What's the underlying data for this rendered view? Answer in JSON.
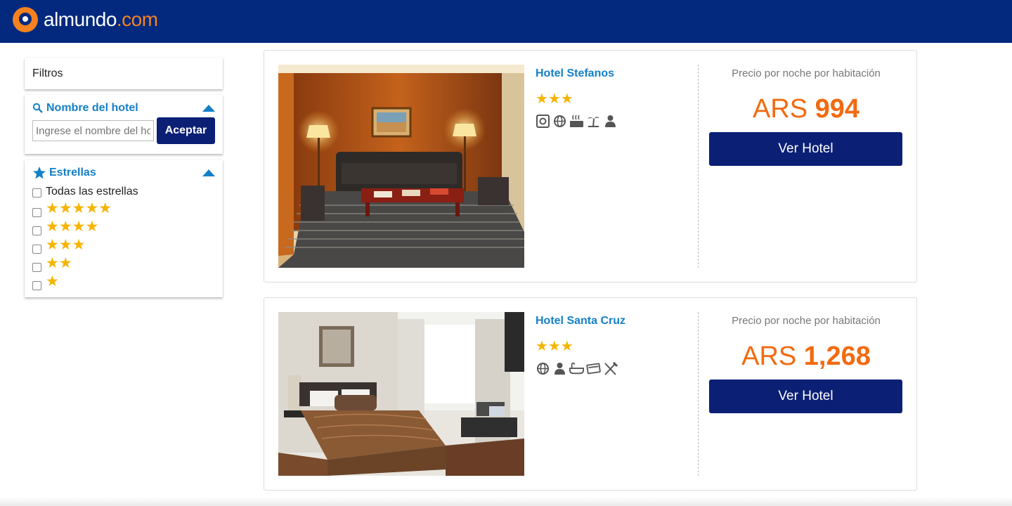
{
  "header": {
    "logo_main": "almundo",
    "logo_tld": ".com"
  },
  "sidebar": {
    "filters_title": "Filtros",
    "name_filter": {
      "title": "Nombre del hotel",
      "placeholder": "Ingrese el nombre del hotel",
      "button_label": "Aceptar"
    },
    "stars_filter": {
      "title": "Estrellas",
      "all_label": "Todas las estrellas",
      "options": [
        {
          "stars": "★★★★★",
          "value": 5
        },
        {
          "stars": "★★★★",
          "value": 4
        },
        {
          "stars": "★★★",
          "value": 3
        },
        {
          "stars": "★★",
          "value": 2
        },
        {
          "stars": "★",
          "value": 1
        }
      ]
    }
  },
  "hotels": [
    {
      "name": "Hotel Stefanos",
      "stars": "★★★",
      "rating": 3,
      "amenities": [
        "safe-icon",
        "globe-icon",
        "spa-icon",
        "beach-icon",
        "person-icon"
      ],
      "price_label": "Precio por noche por habitación",
      "currency": "ARS",
      "price": "994",
      "button_label": "Ver Hotel"
    },
    {
      "name": "Hotel Santa Cruz",
      "stars": "★★★",
      "rating": 3,
      "amenities": [
        "globe-icon",
        "person-icon",
        "bathtub-icon",
        "card-icon",
        "restaurant-icon"
      ],
      "price_label": "Precio por noche por habitación",
      "currency": "ARS",
      "price": "1,268",
      "button_label": "Ver Hotel"
    }
  ],
  "colors": {
    "header_bg": "#02297d",
    "accent_blue": "#1480c8",
    "button_navy": "#0b1f75",
    "price_orange": "#f26a10",
    "star_yellow": "#f5b400"
  }
}
